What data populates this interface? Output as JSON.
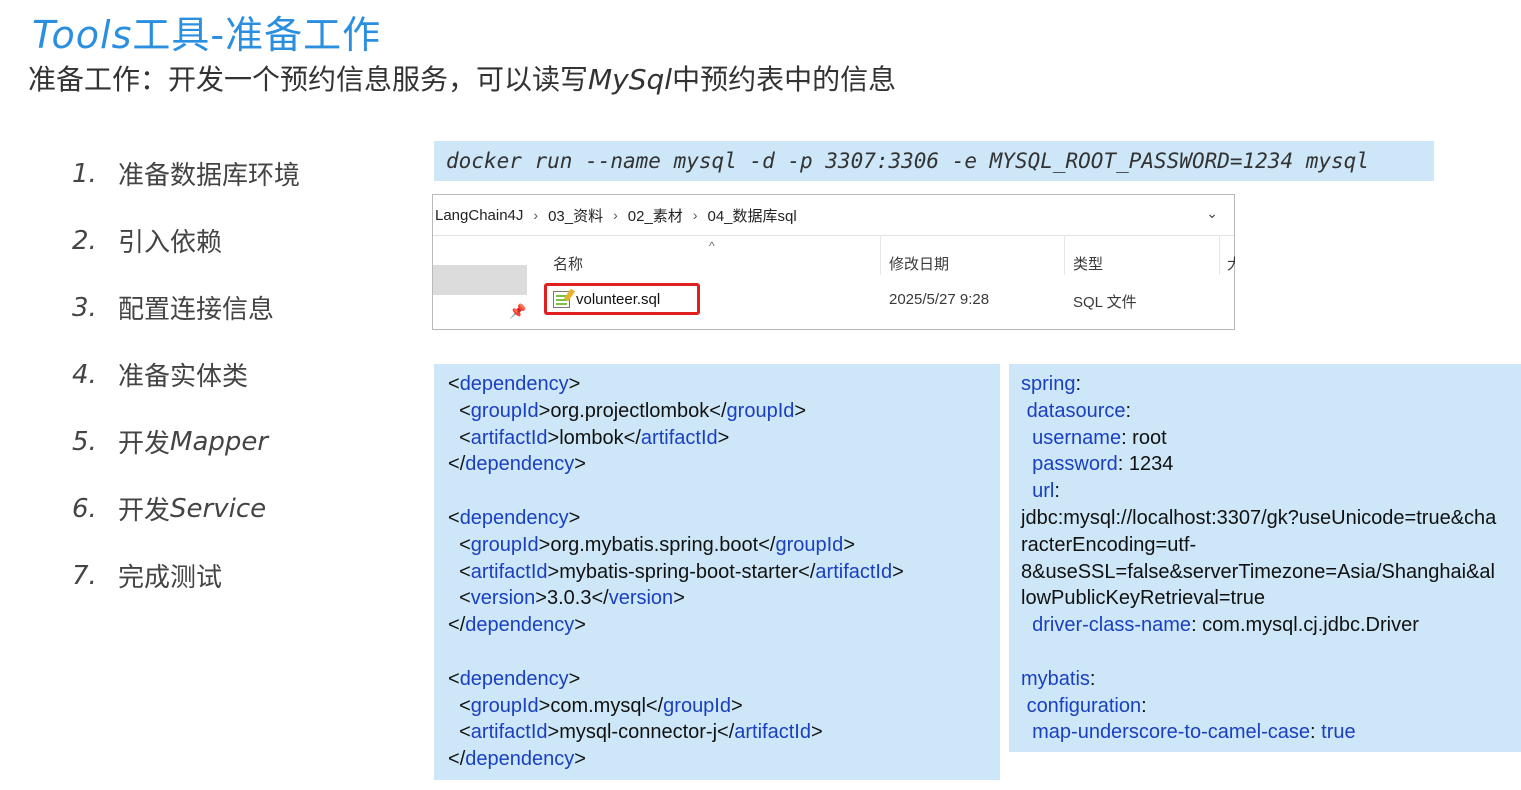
{
  "title": {
    "latin": "Tools",
    "cjk": "工具-准备工作"
  },
  "subtitle": {
    "pre": "准备工作：开发一个预约信息服务，可以读写",
    "em": "MySql",
    "post": "中预约表中的信息"
  },
  "steps": [
    {
      "num": "1.",
      "text": "准备数据库环境",
      "latin": ""
    },
    {
      "num": "2.",
      "text": "引入依赖",
      "latin": ""
    },
    {
      "num": "3.",
      "text": "配置连接信息",
      "latin": ""
    },
    {
      "num": "4.",
      "text": "准备实体类",
      "latin": ""
    },
    {
      "num": "5.",
      "text": "开发",
      "latin": "Mapper"
    },
    {
      "num": "6.",
      "text": "开发",
      "latin": "Service"
    },
    {
      "num": "7.",
      "text": "完成测试",
      "latin": ""
    }
  ],
  "docker_command": "docker run --name mysql -d -p 3307:3306 -e MYSQL_ROOT_PASSWORD=1234 mysql",
  "explorer": {
    "breadcrumb": [
      "LangChain4J",
      "03_资料",
      "02_素材",
      "04_数据库sql"
    ],
    "columns": {
      "name": "名称",
      "modified": "修改日期",
      "type": "类型",
      "size": "大"
    },
    "file": {
      "name": "volunteer.sql",
      "modified": "2025/5/27 9:28",
      "type": "SQL 文件"
    }
  },
  "pom": [
    {
      "lines": [
        {
          "indent": "",
          "open": "dependency",
          "value": "",
          "close": ""
        },
        {
          "indent": "  ",
          "open": "groupId",
          "value": "org.projectlombok",
          "close": "groupId"
        },
        {
          "indent": "  ",
          "open": "artifactId",
          "value": "lombok",
          "close": "artifactId"
        },
        {
          "indent": "",
          "open": "/dependency",
          "value": "",
          "close": ""
        }
      ]
    },
    {
      "lines": [
        {
          "indent": "",
          "open": "dependency",
          "value": "",
          "close": ""
        },
        {
          "indent": "  ",
          "open": "groupId",
          "value": "org.mybatis.spring.boot",
          "close": "groupId"
        },
        {
          "indent": "  ",
          "open": "artifactId",
          "value": "mybatis-spring-boot-starter",
          "close": "artifactId"
        },
        {
          "indent": "  ",
          "open": "version",
          "value": "3.0.3",
          "close": "version"
        },
        {
          "indent": "",
          "open": "/dependency",
          "value": "",
          "close": ""
        }
      ]
    },
    {
      "lines": [
        {
          "indent": "",
          "open": "dependency",
          "value": "",
          "close": ""
        },
        {
          "indent": "  ",
          "open": "groupId",
          "value": "com.mysql",
          "close": "groupId"
        },
        {
          "indent": "  ",
          "open": "artifactId",
          "value": "mysql-connector-j",
          "close": "artifactId"
        },
        {
          "indent": "",
          "open": "/dependency",
          "value": "",
          "close": ""
        }
      ]
    }
  ],
  "yaml": [
    {
      "key": "spring",
      "indent": "",
      "value": ""
    },
    {
      "key": "datasource",
      "indent": " ",
      "value": ""
    },
    {
      "key": "username",
      "indent": "  ",
      "value": " root"
    },
    {
      "key": "password",
      "indent": "  ",
      "value": " 1234"
    },
    {
      "key": "url",
      "indent": "  ",
      "value": ""
    },
    {
      "key": "",
      "indent": "",
      "value": "jdbc:mysql://localhost:3307/gk?useUnicode=true&cha"
    },
    {
      "key": "",
      "indent": "",
      "value": "racterEncoding=utf-"
    },
    {
      "key": "",
      "indent": "",
      "value": "8&useSSL=false&serverTimezone=Asia/Shanghai&al"
    },
    {
      "key": "",
      "indent": "",
      "value": "lowPublicKeyRetrieval=true"
    },
    {
      "key": "driver-class-name",
      "indent": "  ",
      "value": " com.mysql.cj.jdbc.Driver"
    },
    {
      "key": "",
      "indent": "",
      "value": ""
    },
    {
      "key": "mybatis",
      "indent": "",
      "value": ""
    },
    {
      "key": "configuration",
      "indent": " ",
      "value": ""
    },
    {
      "key": "map-underscore-to-camel-case",
      "indent": "  ",
      "value": " true",
      "valueColored": true
    }
  ]
}
